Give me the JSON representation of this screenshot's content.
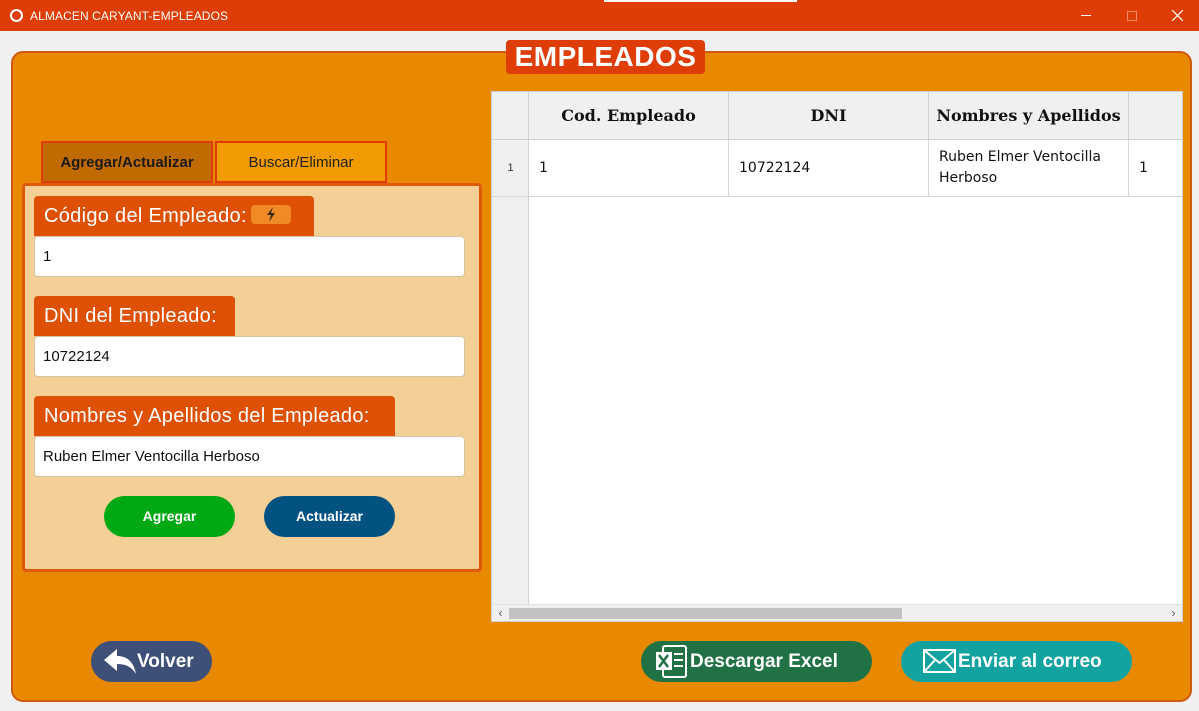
{
  "window": {
    "title": "ALMACEN CARYANT-EMPLEADOS"
  },
  "heading": "EMPLEADOS",
  "tabs": [
    {
      "label": "Agregar/Actualizar"
    },
    {
      "label": "Buscar/Eliminar"
    }
  ],
  "form": {
    "code_label": "Código del Empleado:",
    "code_value": "1",
    "dni_label": "DNI del Empleado:",
    "dni_value": "10722124",
    "name_label": "Nombres y Apellidos del Empleado:",
    "name_value": "Ruben Elmer Ventocilla Herboso",
    "add_button": "Agregar",
    "update_button": "Actualizar"
  },
  "table": {
    "columns": [
      "Cod. Empleado",
      "DNI",
      "Nombres y Apellidos",
      ""
    ],
    "rows": [
      {
        "rownum": "1",
        "cells": [
          "1",
          "10722124",
          "Ruben Elmer Ventocilla Herboso",
          "1"
        ]
      }
    ]
  },
  "bottom": {
    "back_button": "Volver",
    "excel_button": "Descargar Excel",
    "mail_button": "Enviar al correo"
  },
  "colors": {
    "titlebar": "#de3d06",
    "panel": "#e98902",
    "accent": "#de5004",
    "add": "#00a814",
    "update": "#025281",
    "excel": "#207244",
    "mail": "#12a3a0",
    "back": "#3e4f78"
  }
}
